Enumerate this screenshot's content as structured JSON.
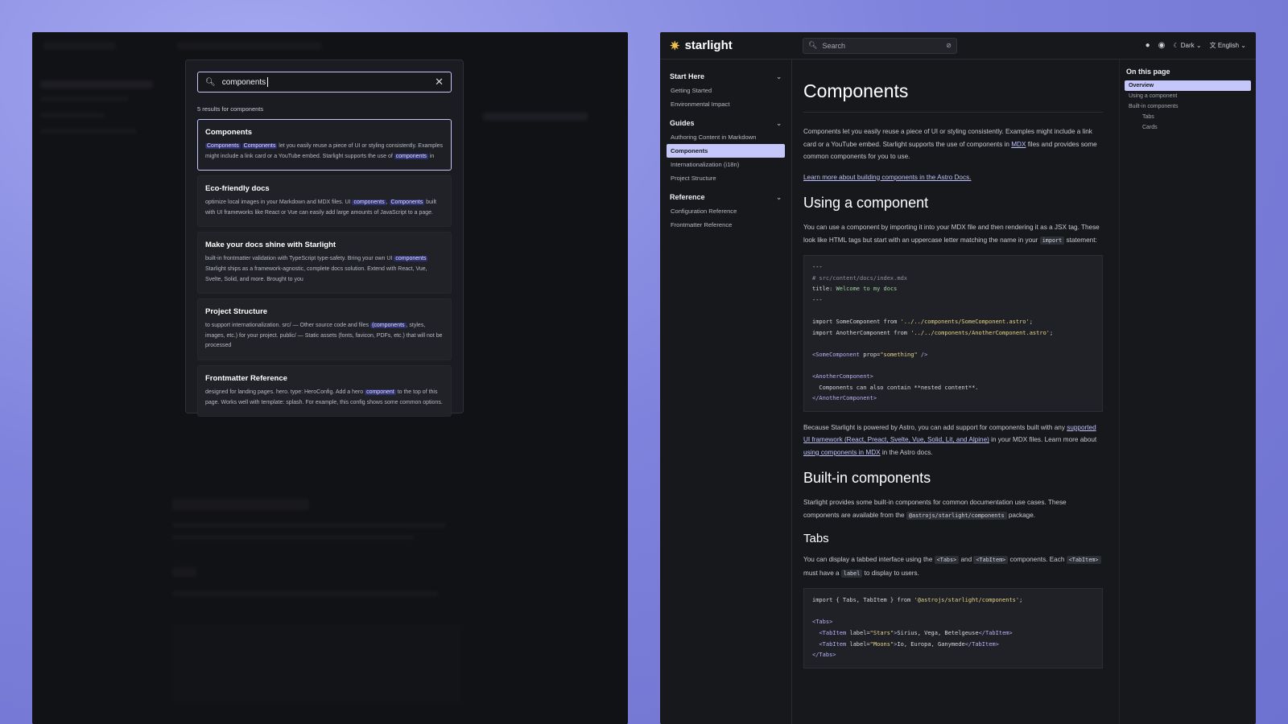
{
  "colors": {
    "accent": "#c5c7fb",
    "background": "#17181c",
    "backdrop": "#8a8ee6"
  },
  "header": {
    "logo": "starlight",
    "search_placeholder": "Search",
    "theme": "Dark",
    "language": "English",
    "icons": [
      "github-icon",
      "discord-icon",
      "moon-icon",
      "translate-icon"
    ]
  },
  "search_modal": {
    "query": "components",
    "results_count_label": "5 results for components",
    "results": [
      {
        "title": "Components",
        "parts": [
          [
            "m",
            "Components"
          ],
          [
            "t",
            " "
          ],
          [
            "m",
            "Components"
          ],
          [
            "t",
            " let you easily reuse a piece of UI or styling consistently. Examples might include a link card or a YouTube embed. Starlight supports the use of "
          ],
          [
            "m",
            "components"
          ],
          [
            "t",
            " in"
          ]
        ]
      },
      {
        "title": "Eco-friendly docs",
        "parts": [
          [
            "t",
            "optimize local images in your Markdown and MDX files. UI "
          ],
          [
            "m",
            "components"
          ],
          [
            "t",
            ", "
          ],
          [
            "m",
            "Components"
          ],
          [
            "t",
            " built with UI frameworks like React or Vue can easily add large amounts of JavaScript to a page."
          ]
        ]
      },
      {
        "title": "Make your docs shine with Starlight",
        "parts": [
          [
            "t",
            "built-in frontmatter validation with TypeScript type-safety. Bring your own UI "
          ],
          [
            "m",
            "components"
          ],
          [
            "t",
            " Starlight ships as a framework-agnostic, complete docs solution. Extend with React, Vue, Svelte, Solid, and more. Brought to you"
          ]
        ]
      },
      {
        "title": "Project Structure",
        "parts": [
          [
            "t",
            "to support internationalization. src/ — Other source code and files "
          ],
          [
            "m",
            "(components"
          ],
          [
            "t",
            ", styles, images, etc.) for your project. public/ — Static assets (fonts, favicon, PDFs, etc.) that will not be processed"
          ]
        ]
      },
      {
        "title": "Frontmatter Reference",
        "parts": [
          [
            "t",
            "designed for landing pages. hero. type: HeroConfig. Add a hero "
          ],
          [
            "m",
            "component"
          ],
          [
            "t",
            " to the top of this page. Works well with template: splash. For example, this config shows some common options."
          ]
        ]
      }
    ]
  },
  "sidebar": {
    "groups": [
      {
        "label": "Start Here",
        "items": [
          {
            "label": "Getting Started"
          },
          {
            "label": "Environmental Impact"
          }
        ]
      },
      {
        "label": "Guides",
        "items": [
          {
            "label": "Authoring Content in Markdown"
          },
          {
            "label": "Components",
            "active": true
          },
          {
            "label": "Internationalization (i18n)"
          },
          {
            "label": "Project Structure"
          }
        ]
      },
      {
        "label": "Reference",
        "items": [
          {
            "label": "Configuration Reference"
          },
          {
            "label": "Frontmatter Reference"
          }
        ]
      }
    ]
  },
  "main": {
    "title": "Components",
    "intro_parts": [
      [
        "t",
        "Components let you easily reuse a piece of UI or styling consistently. Examples might include a link card or a YouTube embed. Starlight supports the use of components in "
      ],
      [
        "a",
        "MDX"
      ],
      [
        "t",
        " files and provides some common components for you to use."
      ]
    ],
    "learn_more_link": "Learn more about building components in the Astro Docs.",
    "using_heading": "Using a component",
    "using_parts": [
      [
        "t",
        "You can use a component by importing it into your MDX file and then rendering it as a JSX tag. These look like HTML tags but start with an uppercase letter matching the name in your "
      ],
      [
        "c",
        "import"
      ],
      [
        "t",
        " statement:"
      ]
    ],
    "code1": [
      [
        [
          "p",
          "---"
        ]
      ],
      [
        [
          "cm",
          "# src/content/docs/index.mdx"
        ]
      ],
      [
        [
          "p",
          "title: "
        ],
        [
          "gr",
          "Welcome to my docs"
        ]
      ],
      [
        [
          "p",
          "---"
        ]
      ],
      [
        [
          "p",
          ""
        ]
      ],
      [
        [
          "p",
          "import SomeComponent from "
        ],
        [
          "st",
          "'../../components/SomeComponent.astro'"
        ],
        [
          "p",
          ";"
        ]
      ],
      [
        [
          "p",
          "import AnotherComponent from "
        ],
        [
          "st",
          "'../../components/AnotherComponent.astro'"
        ],
        [
          "p",
          ";"
        ]
      ],
      [
        [
          "p",
          ""
        ]
      ],
      [
        [
          "tg",
          "<SomeComponent"
        ],
        [
          "p",
          " prop="
        ],
        [
          "st",
          "\"something\""
        ],
        [
          "tg",
          " />"
        ]
      ],
      [
        [
          "p",
          ""
        ]
      ],
      [
        [
          "tg",
          "<AnotherComponent>"
        ]
      ],
      [
        [
          "p",
          "  Components can also contain **nested content**."
        ]
      ],
      [
        [
          "tg",
          "</AnotherComponent>"
        ]
      ]
    ],
    "astro_parts": [
      [
        "t",
        "Because Starlight is powered by Astro, you can add support for components built with any "
      ],
      [
        "a",
        "supported UI framework (React, Preact, Svelte, Vue, Solid, Lit, and Alpine)"
      ],
      [
        "t",
        " in your MDX files. Learn more about "
      ],
      [
        "a",
        "using components in MDX"
      ],
      [
        "t",
        " in the Astro docs."
      ]
    ],
    "builtin_heading": "Built-in components",
    "builtin_parts": [
      [
        "t",
        "Starlight provides some built-in components for common documentation use cases. These components are available from the "
      ],
      [
        "c",
        "@astrojs/starlight/components"
      ],
      [
        "t",
        " package."
      ]
    ],
    "tabs_heading": "Tabs",
    "tabs_parts": [
      [
        "t",
        "You can display a tabbed interface using the "
      ],
      [
        "c",
        "<Tabs>"
      ],
      [
        "t",
        " and "
      ],
      [
        "c",
        "<TabItem>"
      ],
      [
        "t",
        " components. Each "
      ],
      [
        "c",
        "<TabItem>"
      ],
      [
        "t",
        " must have a "
      ],
      [
        "c",
        "label"
      ],
      [
        "t",
        " to display to users."
      ]
    ],
    "code2": [
      [
        [
          "p",
          "import { Tabs, TabItem } from "
        ],
        [
          "st",
          "'@astrojs/starlight/components'"
        ],
        [
          "p",
          ";"
        ]
      ],
      [
        [
          "p",
          ""
        ]
      ],
      [
        [
          "tg",
          "<Tabs>"
        ]
      ],
      [
        [
          "p",
          "  "
        ],
        [
          "tg",
          "<TabItem"
        ],
        [
          "p",
          " label="
        ],
        [
          "st",
          "\"Stars\""
        ],
        [
          "tg",
          ">"
        ],
        [
          "p",
          "Sirius, Vega, Betelgeuse"
        ],
        [
          "tg",
          "</TabItem>"
        ]
      ],
      [
        [
          "p",
          "  "
        ],
        [
          "tg",
          "<TabItem"
        ],
        [
          "p",
          " label="
        ],
        [
          "st",
          "\"Moons\""
        ],
        [
          "tg",
          ">"
        ],
        [
          "p",
          "Io, Europa, Ganymede"
        ],
        [
          "tg",
          "</TabItem>"
        ]
      ],
      [
        [
          "tg",
          "</Tabs>"
        ]
      ]
    ]
  },
  "toc": {
    "heading": "On this page",
    "items": [
      {
        "label": "Overview",
        "active": true
      },
      {
        "label": "Using a component"
      },
      {
        "label": "Built-in components"
      },
      {
        "label": "Tabs",
        "sub": true
      },
      {
        "label": "Cards",
        "sub": true
      }
    ]
  }
}
